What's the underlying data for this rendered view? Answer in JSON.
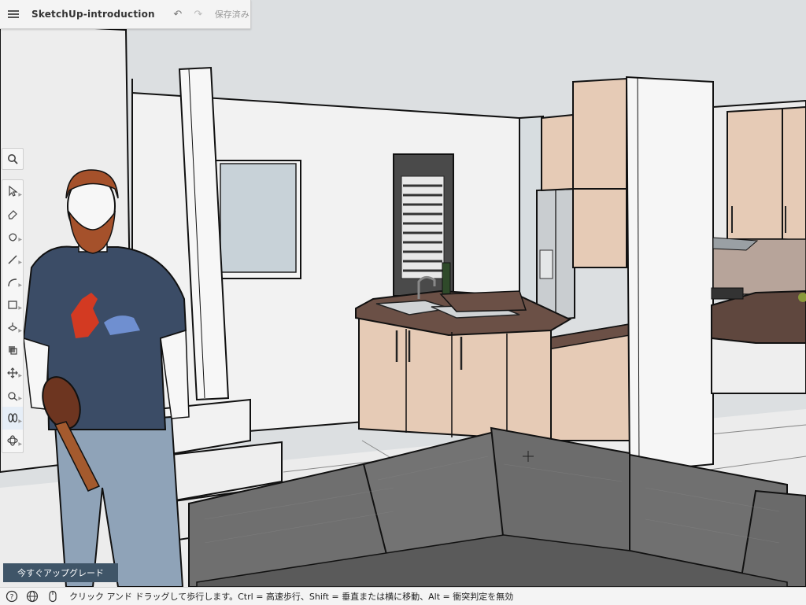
{
  "app": {
    "title": "SketchUp-introduction",
    "save_status": "保存済み",
    "undo_icon": "undo-icon",
    "redo_icon": "redo-icon"
  },
  "toolbar": {
    "search_icon": "search-icon",
    "tools": [
      {
        "icon": "select-icon",
        "active": false
      },
      {
        "icon": "eraser-icon",
        "active": false
      },
      {
        "icon": "paint-bucket-icon",
        "active": false
      },
      {
        "icon": "line-pencil-icon",
        "active": false
      },
      {
        "icon": "arc-icon",
        "active": false
      },
      {
        "icon": "rectangle-icon",
        "active": false
      },
      {
        "icon": "push-pull-icon",
        "active": false
      },
      {
        "icon": "offset-icon",
        "active": false
      },
      {
        "icon": "move-icon",
        "active": false
      },
      {
        "icon": "tape-measure-icon",
        "active": false
      },
      {
        "icon": "walk-icon",
        "active": true
      },
      {
        "icon": "orbit-icon",
        "active": false
      }
    ]
  },
  "upgrade_button": {
    "label": "今すぐアップグレード"
  },
  "statusbar": {
    "help_icon": "help-icon",
    "globe_icon": "globe-icon",
    "mouse_icon": "mouse-icon",
    "message": "クリック アンド ドラッグして歩行します。Ctrl = 高速歩行、Shift = 垂直または横に移動、Alt = 衝突判定を無効"
  },
  "colors": {
    "accent": "#3f5568",
    "toolbar_bg": "#f6f6f6",
    "sky": "#dcdfe1",
    "walls": "#f1f1f1",
    "cabinet": "#e6cbb6",
    "sofa": "#6e6e6e"
  }
}
